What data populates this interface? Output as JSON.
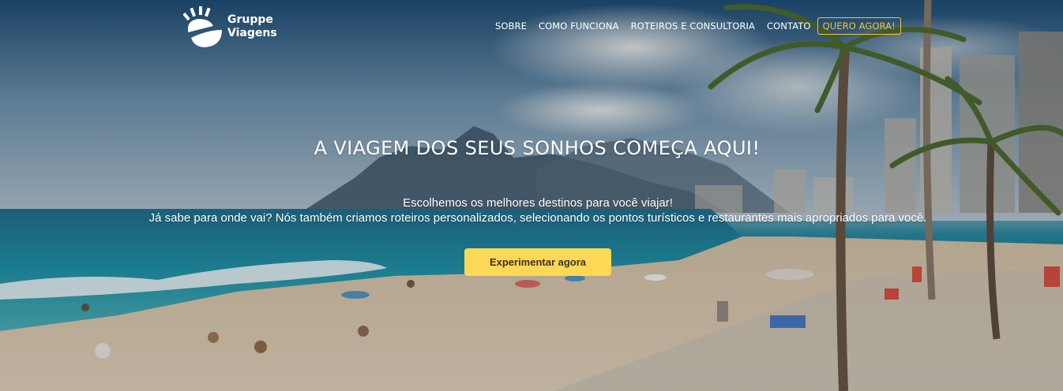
{
  "brand": {
    "name_line1": "Gruppe",
    "name_line2": "Viagens"
  },
  "nav": {
    "items": [
      {
        "label": "SOBRE"
      },
      {
        "label": "COMO FUNCIONA"
      },
      {
        "label": "ROTEIROS E CONSULTORIA"
      },
      {
        "label": "CONTATO"
      }
    ],
    "cta_label": "QUERO AGORA!"
  },
  "hero": {
    "headline": "A VIAGEM DOS SEUS SONHOS COMEÇA AQUI!",
    "subtitle_line1": "Escolhemos os melhores destinos para você viajar!",
    "subtitle_line2": "Já sabe para onde vai? Nós também criamos roteiros personalizados, selecionando os pontos turísticos e restaurantes mais apropriados para você.",
    "button_label": "Experimentar agora"
  },
  "colors": {
    "accent": "#f4c430",
    "button_bg": "#fdd856",
    "text": "#ffffff"
  }
}
